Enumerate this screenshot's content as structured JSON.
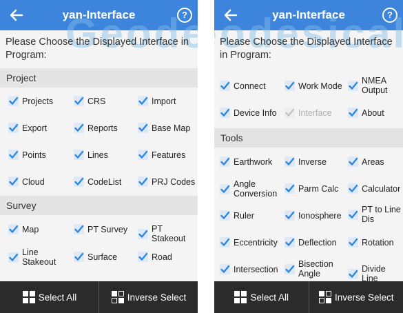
{
  "header": {
    "title": "yan-Interface",
    "help": "?"
  },
  "watermark": "Geodesical",
  "prompt": "Please Choose the Displayed Interface in Program:",
  "sections": {
    "project": "Project",
    "survey": "Survey",
    "tools": "Tools"
  },
  "items": {
    "projects": "Projects",
    "crs": "CRS",
    "import": "Import",
    "export": "Export",
    "reports": "Reports",
    "base_map": "Base Map",
    "points": "Points",
    "lines": "Lines",
    "features": "Features",
    "cloud": "Cloud",
    "codelist": "CodeList",
    "prj_codes": "PRJ Codes",
    "map": "Map",
    "pt_survey": "PT Survey",
    "pt_stakeout": "PT Stakeout",
    "line_stakeout": "Line Stakeout",
    "surface": "Surface",
    "road": "Road",
    "connect": "Connect",
    "work_mode": "Work Mode",
    "nmea_output": "NMEA Output",
    "device_info": "Device Info",
    "interface": "Interface",
    "about": "About",
    "earthwork": "Earthwork",
    "inverse": "Inverse",
    "areas": "Areas",
    "angle_conversion": "Angle Conversion",
    "parm_calc": "Parm Calc",
    "calculator": "Calculator",
    "ruler": "Ruler",
    "ionosphere": "Ionosphere",
    "pt_to_line_dis": "PT to Line Dis",
    "eccentricity": "Eccentricity",
    "deflection": "Deflection",
    "rotation": "Rotation",
    "intersection": "Intersection",
    "bisection_angle": "Bisection Angle",
    "divide_line": "Divide Line"
  },
  "footer": {
    "select_all": "Select All",
    "inverse_select": "Inverse Select"
  },
  "colors": {
    "accent": "#3d84dc",
    "check": "#2e86de",
    "footer": "#2b2b2b"
  }
}
